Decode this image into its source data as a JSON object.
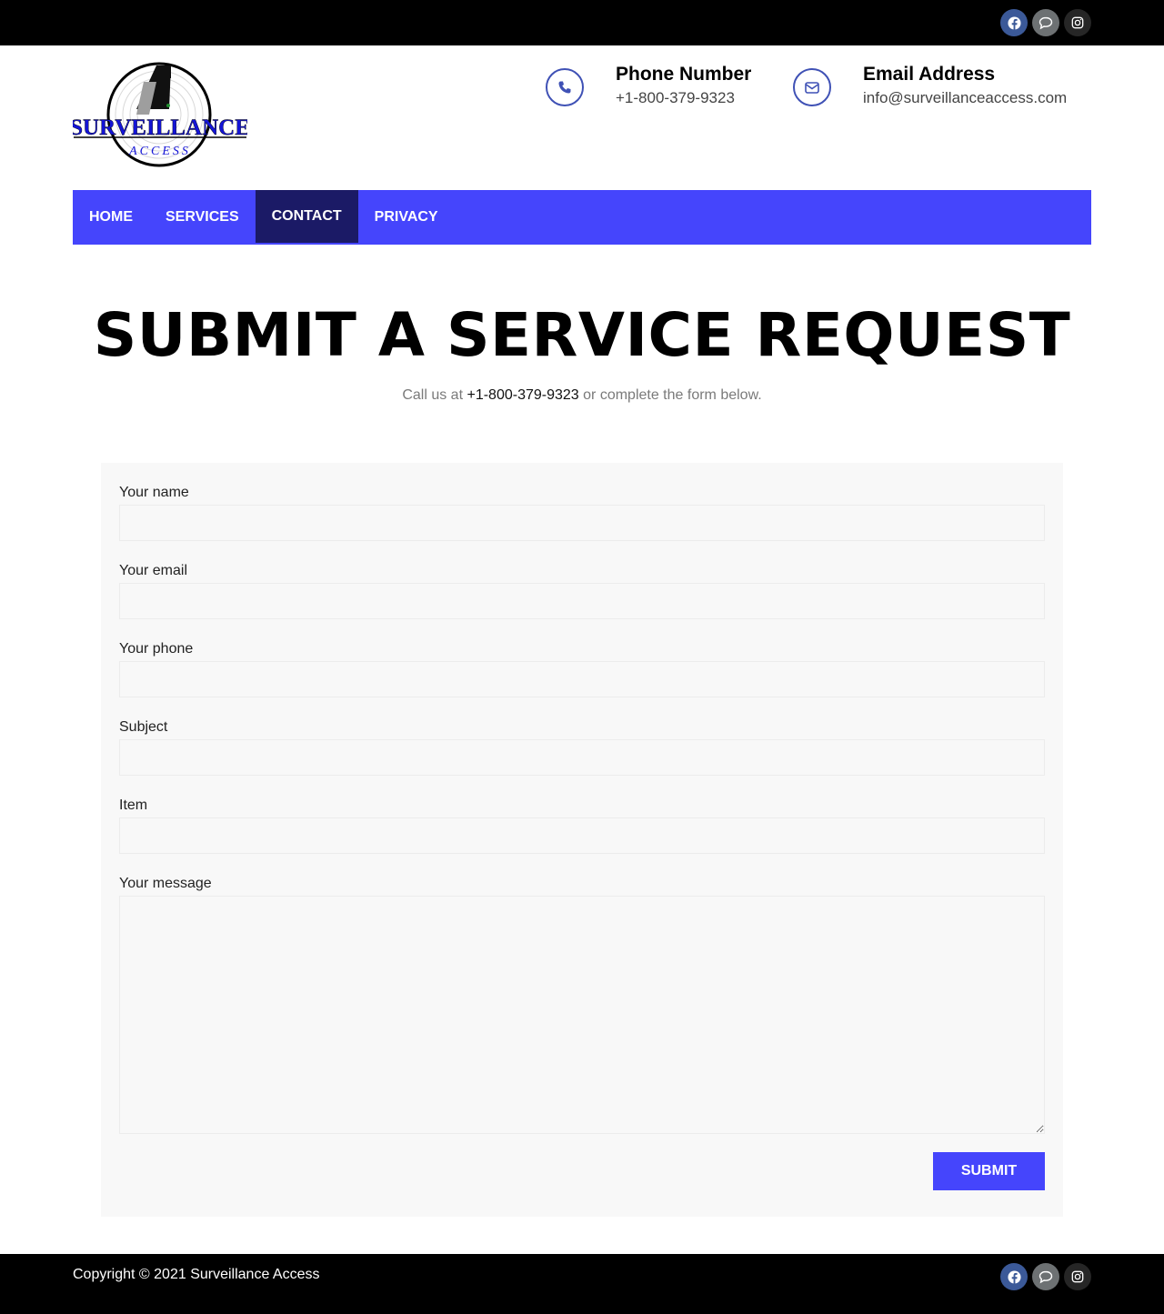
{
  "social": {
    "icons": [
      "facebook-icon",
      "chat-icon",
      "instagram-icon"
    ],
    "colors": {
      "facebook": "#3b5998",
      "chat": "#6d7173",
      "instagram": "#262626"
    }
  },
  "logo": {
    "text_main": "SURVEILLANCE",
    "text_sub": "ACCESS"
  },
  "header": {
    "phone": {
      "title": "Phone Number",
      "value": "+1-800-379-9323",
      "icon": "phone-icon"
    },
    "email": {
      "title": "Email Address",
      "value": "info@surveillanceaccess.com",
      "icon": "envelope-icon"
    }
  },
  "nav": {
    "items": [
      {
        "label": "HOME"
      },
      {
        "label": "SERVICES"
      },
      {
        "label": "CONTACT",
        "active": true
      },
      {
        "label": "PRIVACY"
      }
    ],
    "colors": {
      "bar": "#4545fc",
      "active": "#1b1a66"
    }
  },
  "main": {
    "title": "SUBMIT A SERVICE REQUEST",
    "subtitle_prefix": "Call us at",
    "subtitle_phone": "+1-800-379-9323",
    "subtitle_suffix": "or complete the form below."
  },
  "form": {
    "fields": [
      {
        "label": "Your name",
        "value": "",
        "placeholder": ""
      },
      {
        "label": "Your email",
        "value": "",
        "placeholder": ""
      },
      {
        "label": "Your phone",
        "value": "",
        "placeholder": ""
      },
      {
        "label": "Subject",
        "value": "",
        "placeholder": ""
      },
      {
        "label": "Item",
        "value": "",
        "placeholder": ""
      },
      {
        "label": "Your message",
        "value": "",
        "placeholder": ""
      }
    ],
    "submit_label": "SUBMIT"
  },
  "footer": {
    "copyright": "Copyright © 2021 Surveillance Access"
  }
}
